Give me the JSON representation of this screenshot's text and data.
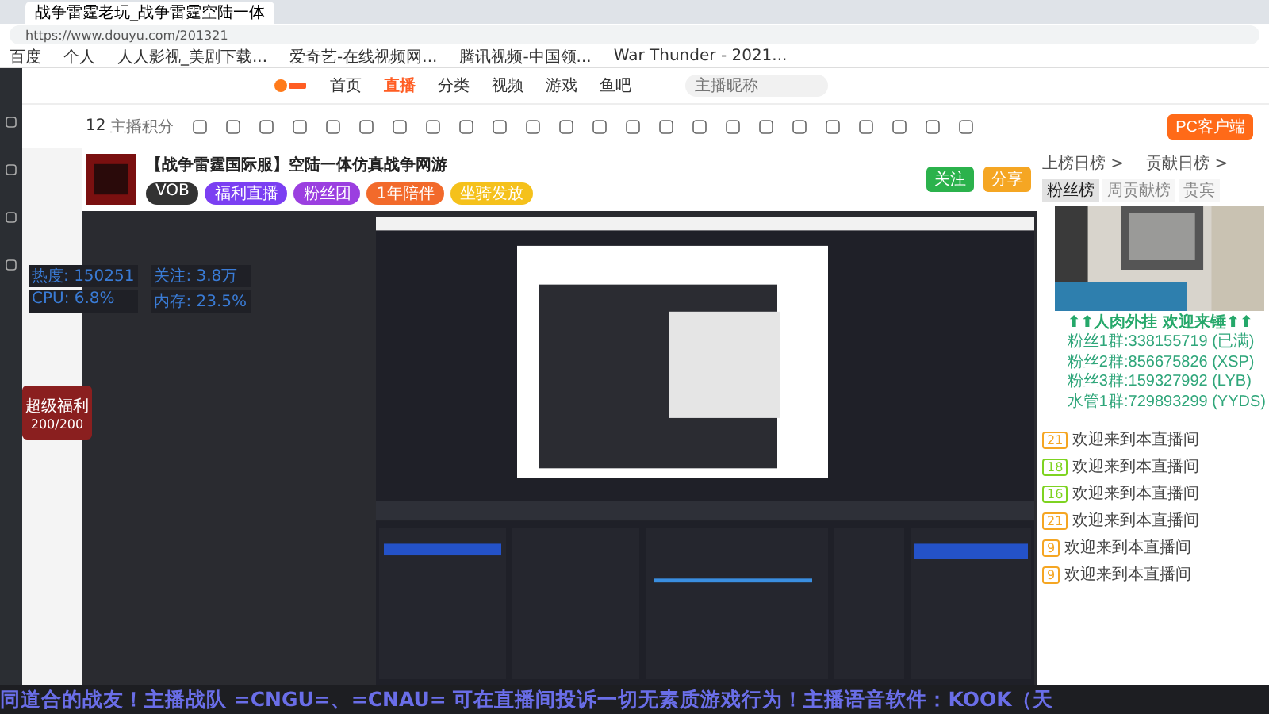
{
  "browser": {
    "tab_title": "战争雷霆老玩_战争雷霆空陆一体",
    "url": "https://www.douyu.com/201321",
    "bookmarks": [
      "百度",
      "个人",
      "人人影视_美剧下载...",
      "爱奇艺-在线视频网...",
      "腾讯视频-中国领...",
      "War Thunder - 2021..."
    ]
  },
  "header": {
    "nav": [
      {
        "label": "首页",
        "selected": false
      },
      {
        "label": "直播",
        "selected": true
      },
      {
        "label": "分类",
        "selected": false
      },
      {
        "label": "视频",
        "selected": false
      },
      {
        "label": "游戏",
        "selected": false
      },
      {
        "label": "鱼吧",
        "selected": false
      }
    ],
    "search": {
      "placeholder": "主播昵称"
    }
  },
  "category_bar": {
    "count": "12",
    "count_label": "主播积分",
    "client_button": "PC客户端"
  },
  "room": {
    "title": "【战争雷霆国际服】空陆一体仿真战争网游",
    "tags": [
      {
        "label": "VOB",
        "color": "#333333"
      },
      {
        "label": "福利直播",
        "color": "#7b3ff2"
      },
      {
        "label": "粉丝团",
        "color": "#9b3fe0"
      },
      {
        "label": "1年陪伴",
        "color": "#f26a2b"
      },
      {
        "label": "坐骑发放",
        "color": "#f5c11b"
      }
    ],
    "follow_button": "关注",
    "share_button": "分享"
  },
  "stats": [
    {
      "label": "热度:",
      "value": "150251"
    },
    {
      "label": "关注:",
      "value": "3.8万"
    },
    {
      "label": "CPU:",
      "value": "6.8%"
    },
    {
      "label": "内存:",
      "value": "23.5%"
    }
  ],
  "gift_badge": {
    "label": "超级福利",
    "value": "200/200"
  },
  "chat": {
    "top_links": [
      "上榜日榜 >",
      "贡献日榜 >"
    ],
    "tabs": [
      {
        "label": "粉丝榜",
        "selected": true
      },
      {
        "label": "周贡献榜",
        "selected": false
      },
      {
        "label": "贵宾",
        "selected": false
      }
    ],
    "messages": [
      {
        "level": "21",
        "color": "#f5a623",
        "text": "欢迎来到本直播间"
      },
      {
        "level": "18",
        "color": "#7ed321",
        "text": "欢迎来到本直播间"
      },
      {
        "level": "16",
        "color": "#7ed321",
        "text": "欢迎来到本直播间"
      },
      {
        "level": "21",
        "color": "#f5a623",
        "text": "欢迎来到本直播间"
      },
      {
        "level": "9",
        "color": "#f5a623",
        "text": "欢迎来到本直播间"
      },
      {
        "level": "9",
        "color": "#f5a623",
        "text": "欢迎来到本直播间"
      }
    ]
  },
  "overlay": {
    "headline": "⬆⬆人肉外挂 欢迎来锤⬆⬆",
    "groups": [
      "粉丝1群:338155719 (已满)",
      "粉丝2群:856675826 (XSP)",
      "粉丝3群:159327992 (LYB)",
      "水管1群:729893299 (YYDS)"
    ],
    "ticker": "同道合的战友！主播战队 =CNGU=、=CNAU= 可在直播间投诉一切无素质游戏行为！主播语音软件：KOOK（天"
  }
}
